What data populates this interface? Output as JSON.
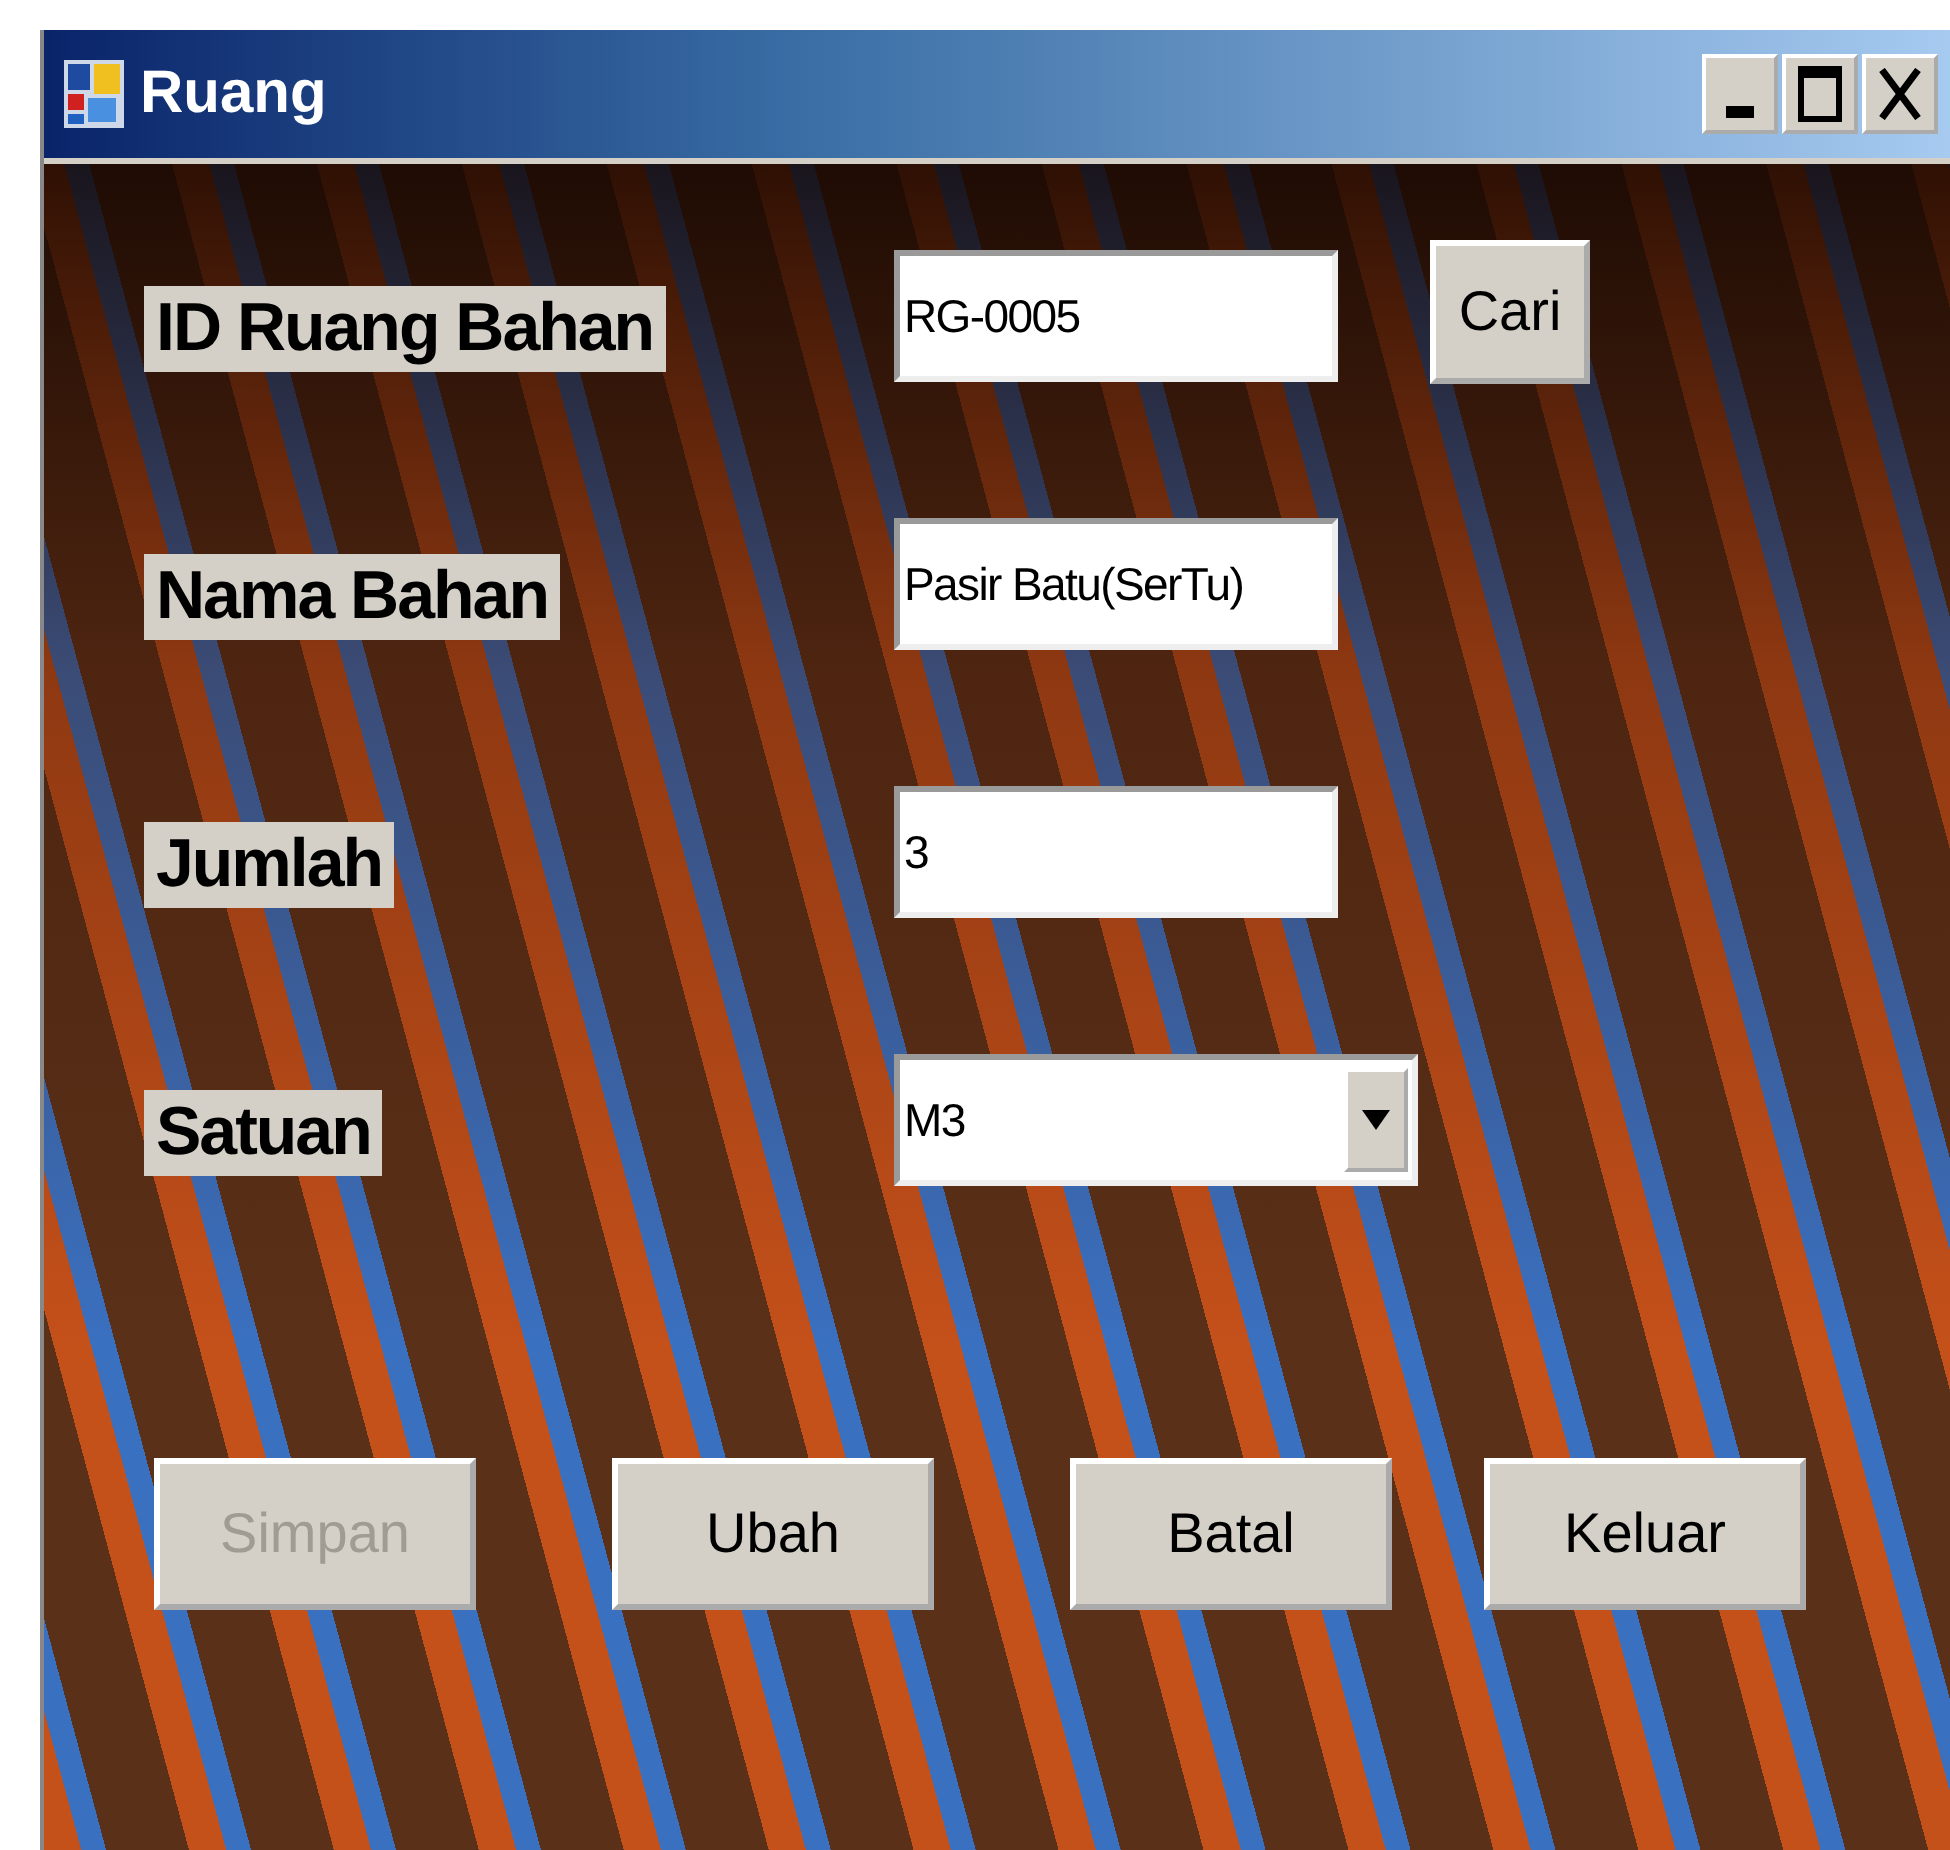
{
  "window": {
    "title": "Ruang"
  },
  "fields": [
    {
      "label": "ID Ruang Bahan",
      "kind": "text",
      "value": "RG-0005",
      "button": "Cari"
    },
    {
      "label": "Nama Bahan",
      "kind": "text",
      "value": "Pasir Batu(SerTu)"
    },
    {
      "label": "Jumlah",
      "kind": "text",
      "value": "3"
    },
    {
      "label": "Satuan",
      "kind": "dropdown",
      "value": "M3"
    }
  ],
  "buttons": [
    {
      "label": "Simpan",
      "disabled": true
    },
    {
      "label": "Ubah",
      "disabled": false
    },
    {
      "label": "Batal",
      "disabled": false
    },
    {
      "label": "Keluar",
      "disabled": false
    }
  ]
}
